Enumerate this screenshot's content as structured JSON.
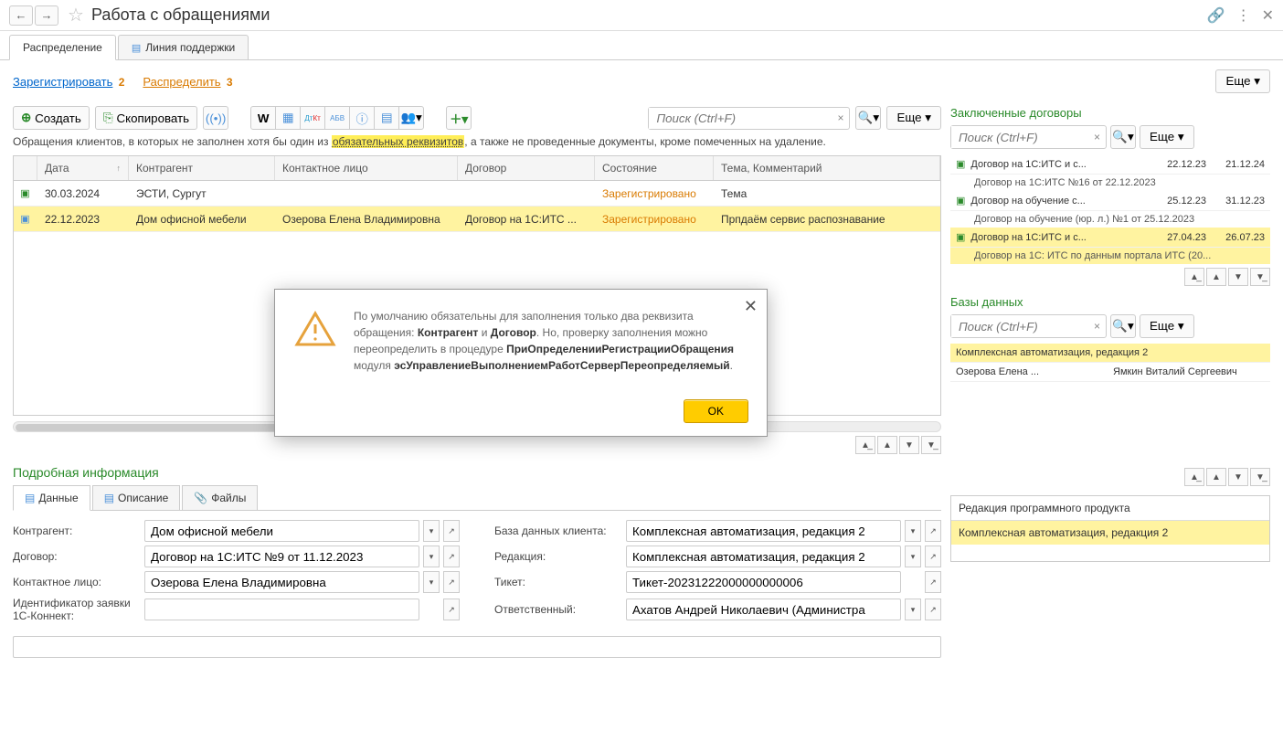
{
  "title": "Работа с обращениями",
  "tabs": {
    "t1": "Распределение",
    "t2": "Линия поддержки"
  },
  "links": {
    "register": "Зарегистрировать",
    "register_count": "2",
    "distribute": "Распределить",
    "distribute_count": "3"
  },
  "more_label": "Еще",
  "toolbar": {
    "create": "Создать",
    "copy": "Скопировать"
  },
  "search_placeholder": "Поиск (Ctrl+F)",
  "filter_text": {
    "prefix": "Обращения клиентов, в которых не заполнен хотя бы один из ",
    "highlighted": "обязательных реквизитов",
    "suffix": ", а также не проведенные документы, кроме помеченных на удаление."
  },
  "grid_headers": {
    "date": "Дата",
    "partner": "Контрагент",
    "contact": "Контактное лицо",
    "contract": "Договор",
    "state": "Состояние",
    "topic": "Тема, Комментарий"
  },
  "rows": [
    {
      "date": "30.03.2024",
      "partner": "ЭСТИ, Сургут",
      "contact": "",
      "contract": "",
      "state": "Зарегистрировано",
      "topic": "Тема"
    },
    {
      "date": "22.12.2023",
      "partner": "Дом офисной мебели",
      "contact": "Озерова Елена Владимировна",
      "contract": "Договор на 1С:ИТС ...",
      "state": "Зарегистрировано",
      "topic": "Прпдаём сервис распознавание"
    }
  ],
  "detail_title": "Подробная информация",
  "detail_tabs": {
    "data": "Данные",
    "desc": "Описание",
    "files": "Файлы"
  },
  "form": {
    "partner_label": "Контрагент:",
    "partner_value": "Дом офисной мебели",
    "db_label": "База данных клиента:",
    "db_value": "Комплексная автоматизация, редакция 2",
    "contract_label": "Договор:",
    "contract_value": "Договор на 1С:ИТС №9 от 11.12.2023",
    "edition_label": "Редакция:",
    "edition_value": "Комплексная автоматизация, редакция 2",
    "contact_label": "Контактное лицо:",
    "contact_value": "Озерова Елена Владимировна",
    "ticket_label": "Тикет:",
    "ticket_value": "Тикет-20231222000000000006",
    "id_label": "Идентификатор заявки 1С-Коннект:",
    "id_value": "",
    "resp_label": "Ответственный:",
    "resp_value": "Ахатов Андрей Николаевич (Администра"
  },
  "contracts": {
    "title": "Заключенные договоры",
    "items": [
      {
        "name": "Договор на 1С:ИТС и с...",
        "d1": "22.12.23",
        "d2": "21.12.24",
        "sub": "Договор на 1С:ИТС №16 от 22.12.2023"
      },
      {
        "name": "Договор на обучение с...",
        "d1": "25.12.23",
        "d2": "31.12.23",
        "sub": "Договор на обучение (юр. л.) №1 от 25.12.2023"
      },
      {
        "name": "Договор на 1С:ИТС и с...",
        "d1": "27.04.23",
        "d2": "26.07.23",
        "sub": "Договор на 1С: ИТС по данным портала ИТС (20..."
      }
    ]
  },
  "databases": {
    "title": "Базы данных",
    "row_name": "Комплексная автоматизация, редакция 2",
    "row_p1": "Озерова Елена ...",
    "row_p2": "Ямкин Виталий Сергеевич"
  },
  "product": {
    "title": "Редакция программного продукта",
    "row": "Комплексная автоматизация, редакция 2"
  },
  "dialog": {
    "t1": "По умолчанию обязательны для заполнения только два реквизита обращения: ",
    "b1": "Контрагент",
    "and": " и ",
    "b2": "Договор",
    "t2": ". Но, проверку заполнения можно переопределить в процедуре ",
    "b3": "ПриОпределенииРегистрацииОбращения",
    "t3": " модуля ",
    "b4": "эсУправлениеВыполнениемРаботСерверПереопределяемый",
    "t4": ".",
    "ok": "OK"
  }
}
